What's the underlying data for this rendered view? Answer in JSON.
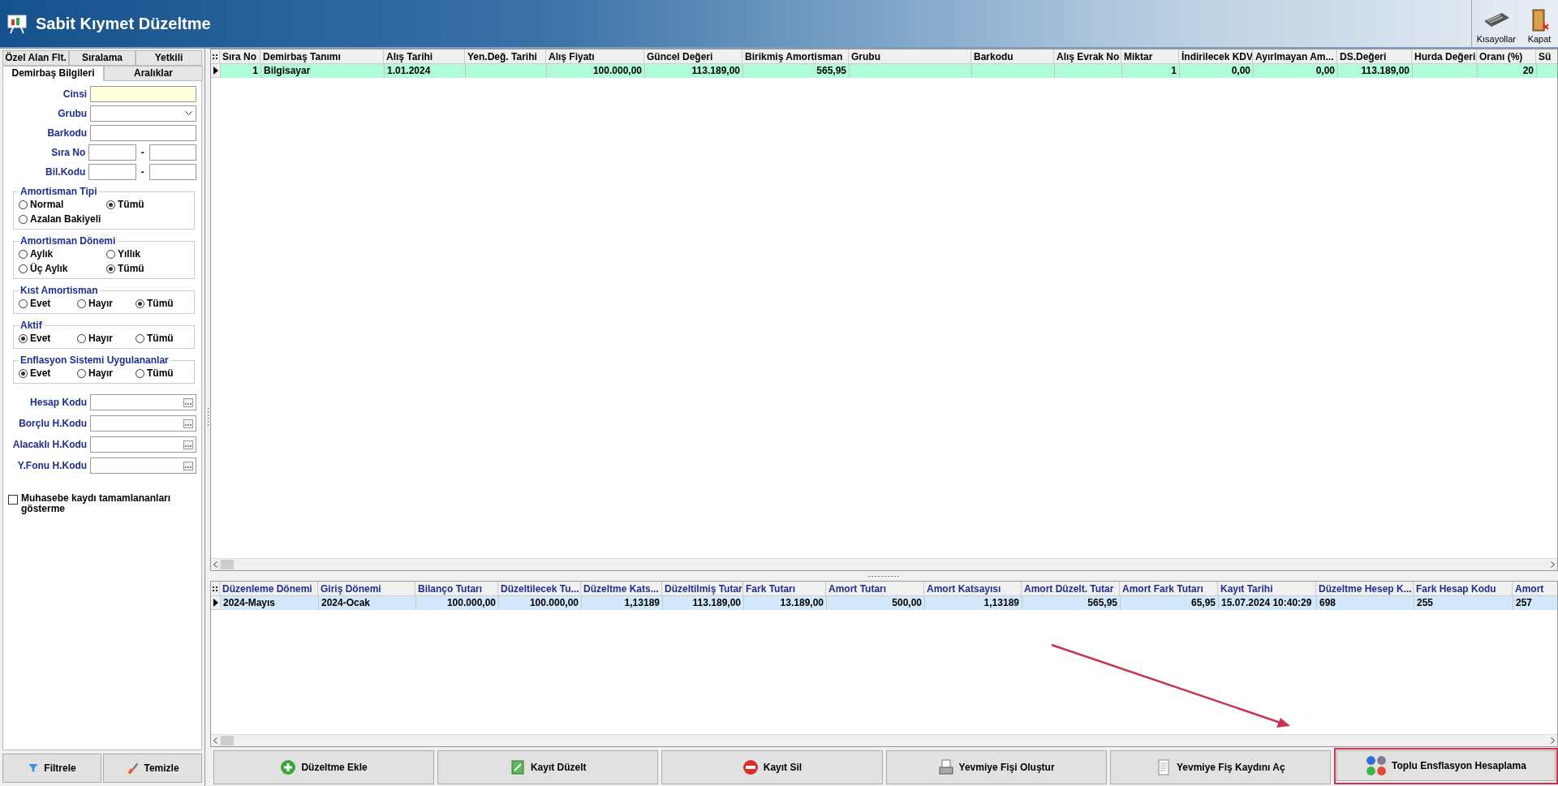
{
  "window": {
    "title": "Sabit Kıymet Düzeltme"
  },
  "toolbar": [
    {
      "label": "Kısayollar",
      "kind": "shortcuts"
    },
    {
      "label": "Kapat",
      "kind": "close"
    }
  ],
  "filter_panel": {
    "tab_rows": [
      [
        {
          "label": "Özel Alan Flt.",
          "selected": false
        },
        {
          "label": "Sıralama",
          "selected": false
        },
        {
          "label": "Yetkili",
          "selected": false
        }
      ],
      [
        {
          "label": "Demirbaş Bilgileri",
          "selected": true
        },
        {
          "label": "Aralıklar",
          "selected": false
        }
      ]
    ],
    "fields": [
      {
        "label": "Cinsi",
        "kind": "highlighted"
      },
      {
        "label": "Grubu",
        "kind": "dropdown"
      },
      {
        "label": "Barkodu",
        "kind": "text"
      },
      {
        "label": "Sıra No",
        "kind": "range",
        "separator": "-"
      },
      {
        "label": "Bil.Kodu",
        "kind": "range",
        "separator": "-"
      }
    ],
    "radio_groups": [
      {
        "title": "Amortisman Tipi",
        "kind": "two-column",
        "options": [
          {
            "label": "Normal",
            "selected": false
          },
          {
            "label": "Tümü",
            "selected": true
          },
          {
            "label": "Azalan Bakiyeli",
            "selected": false
          }
        ]
      },
      {
        "title": "Amortisman Dönemi",
        "kind": "two-column",
        "options": [
          {
            "label": "Aylık",
            "selected": false
          },
          {
            "label": "Yıllık",
            "selected": false
          },
          {
            "label": "Üç Aylık",
            "selected": false
          },
          {
            "label": "Tümü",
            "selected": true
          }
        ]
      },
      {
        "title": "Kıst Amortisman",
        "kind": "three-column",
        "options": [
          {
            "label": "Evet",
            "selected": false
          },
          {
            "label": "Hayır",
            "selected": false
          },
          {
            "label": "Tümü",
            "selected": true
          }
        ]
      },
      {
        "title": "Aktif",
        "kind": "three-column",
        "options": [
          {
            "label": "Evet",
            "selected": true
          },
          {
            "label": "Hayır",
            "selected": false
          },
          {
            "label": "Tümü",
            "selected": false
          }
        ]
      },
      {
        "title": "Enflasyon Sistemi Uygulananlar",
        "kind": "three-column",
        "options": [
          {
            "label": "Evet",
            "selected": true
          },
          {
            "label": "Hayır",
            "selected": false
          },
          {
            "label": "Tümü",
            "selected": false
          }
        ]
      }
    ],
    "lookup_fields": [
      {
        "label": "Hesap Kodu"
      },
      {
        "label": "Borçlu H.Kodu"
      },
      {
        "label": "Alacaklı H.Kodu"
      },
      {
        "label": "Y.Fonu H.Kodu"
      }
    ],
    "checkbox": {
      "label": "Muhasebe kaydı tamamlananları gösterme",
      "checked": false
    },
    "buttons": [
      {
        "label": "Filtrele",
        "kind": "filter"
      },
      {
        "label": "Temizle",
        "kind": "clear"
      }
    ]
  },
  "assets_table": {
    "columns": [
      "Sıra No",
      "Demirbaş Tanımı",
      "Alış Tarihi",
      "Yen.Değ. Tarihi",
      "Alış Fiyatı",
      "Güncel Değeri",
      "Birikmiş Amortisman",
      "Grubu",
      "Barkodu",
      "Alış Evrak No",
      "Miktar",
      "İndirilecek KDV",
      "Ayırlmayan Am...",
      "DS.Değeri",
      "Hurda Değeri",
      "Oranı (%)",
      "Sü"
    ],
    "rows": [
      {
        "selected": true,
        "cells": [
          "1",
          "Bilgisayar",
          "1.01.2024",
          null,
          "100.000,00",
          "113.189,00",
          "565,95",
          null,
          null,
          null,
          "1",
          "0,00",
          "0,00",
          "113.189,00",
          null,
          "20",
          null
        ]
      }
    ]
  },
  "adjustments_table": {
    "columns": [
      "Düzenleme Dönemi",
      "Giriş Dönemi",
      "Bilanço Tutarı",
      "Düzeltilecek Tu...",
      "Düzeltme Kats...",
      "Düzeltilmiş Tutar",
      "Fark Tutarı",
      "Amort Tutarı",
      "Amort Katsayısı",
      "Amort Düzelt. Tutar",
      "Amort Fark Tutarı",
      "Kayıt Tarihi",
      "Düzeltme Hesep K...",
      "Fark Hesap Kodu",
      "Amort"
    ],
    "rows": [
      {
        "selected": true,
        "cells": [
          "2024-Mayıs",
          "2024-Ocak",
          "100.000,00",
          "100.000,00",
          "1,13189",
          "113.189,00",
          "13.189,00",
          "500,00",
          "1,13189",
          "565,95",
          "65,95",
          "15.07.2024 10:40:29",
          "698",
          "255",
          "257"
        ]
      }
    ]
  },
  "actions": [
    {
      "label": "Düzeltme Ekle",
      "kind": "add",
      "highlighted": false
    },
    {
      "label": "Kayıt Düzelt",
      "kind": "edit",
      "highlighted": false
    },
    {
      "label": "Kayıt Sil",
      "kind": "delete",
      "highlighted": false
    },
    {
      "label": "Yevmiye Fişi Oluştur",
      "kind": "print",
      "highlighted": false
    },
    {
      "label": "Yevmiye Fiş Kaydını Aç",
      "kind": "document",
      "highlighted": false
    },
    {
      "label": "Toplu Ensflasyon Hesaplama",
      "kind": "balls",
      "highlighted": true
    }
  ],
  "annotation": {
    "kind": "arrow"
  }
}
